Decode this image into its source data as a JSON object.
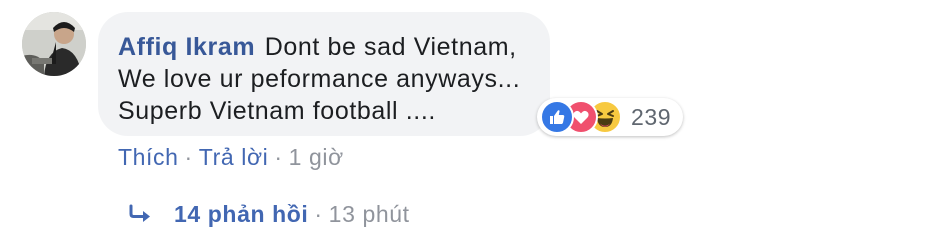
{
  "comment": {
    "author": "Affiq Ikram",
    "lines": [
      "Dont be sad Vietnam,",
      "We love ur peformance anyways...",
      "Superb Vietnam football ...."
    ]
  },
  "reactions": {
    "icons": [
      "like-icon",
      "love-icon",
      "haha-icon"
    ],
    "count": "239",
    "colors": {
      "like": "#3578e5",
      "love": "#f0506e",
      "haha": "#f7c940"
    }
  },
  "actions": {
    "like_label": "Thích",
    "reply_label": "Trả lời",
    "separator": "·",
    "time": "1 giờ"
  },
  "replies": {
    "icon": "reply-arrow-icon",
    "label": "14 phản hồi",
    "separator": "·",
    "time": "13 phút"
  },
  "colors": {
    "bubble_bg": "#f2f3f5",
    "author": "#385898",
    "link": "#4267b2",
    "meta": "#90949c"
  }
}
